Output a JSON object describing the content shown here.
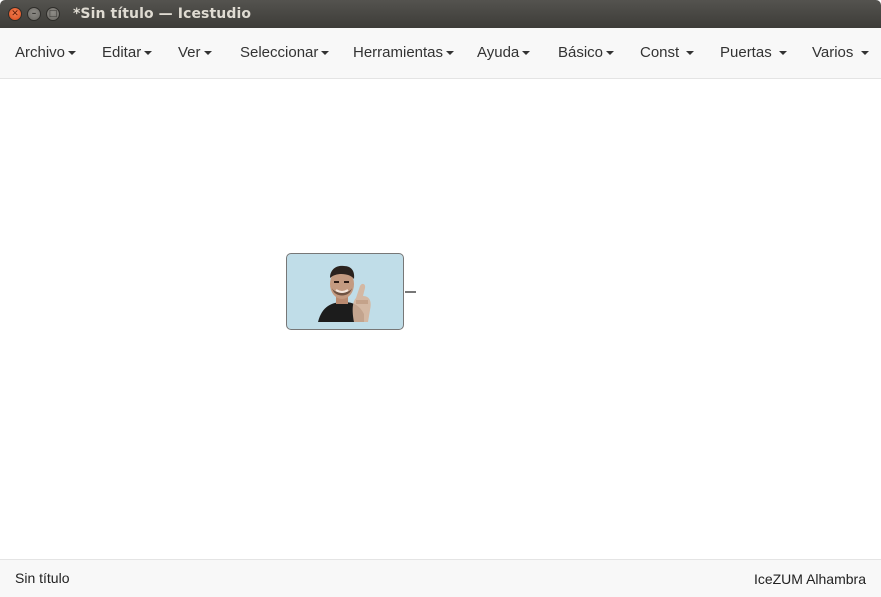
{
  "window": {
    "title": "*Sin título — Icestudio",
    "close_glyph": "✕",
    "minimize_glyph": "–",
    "maximize_glyph": "□"
  },
  "menubar": {
    "items": [
      {
        "label": "Archivo"
      },
      {
        "label": "Editar"
      },
      {
        "label": "Ver"
      },
      {
        "label": "Seleccionar"
      },
      {
        "label": "Herramientas"
      },
      {
        "label": "Ayuda"
      },
      {
        "label": "Básico"
      },
      {
        "label": "Const"
      },
      {
        "label": "Puertas"
      },
      {
        "label": "Varios"
      }
    ]
  },
  "canvas": {
    "block": {
      "type": "image-block",
      "icon": "person-photo-icon",
      "color": "#c0dde8"
    }
  },
  "status": {
    "file": "Sin título",
    "board": "IceZUM Alhambra"
  }
}
